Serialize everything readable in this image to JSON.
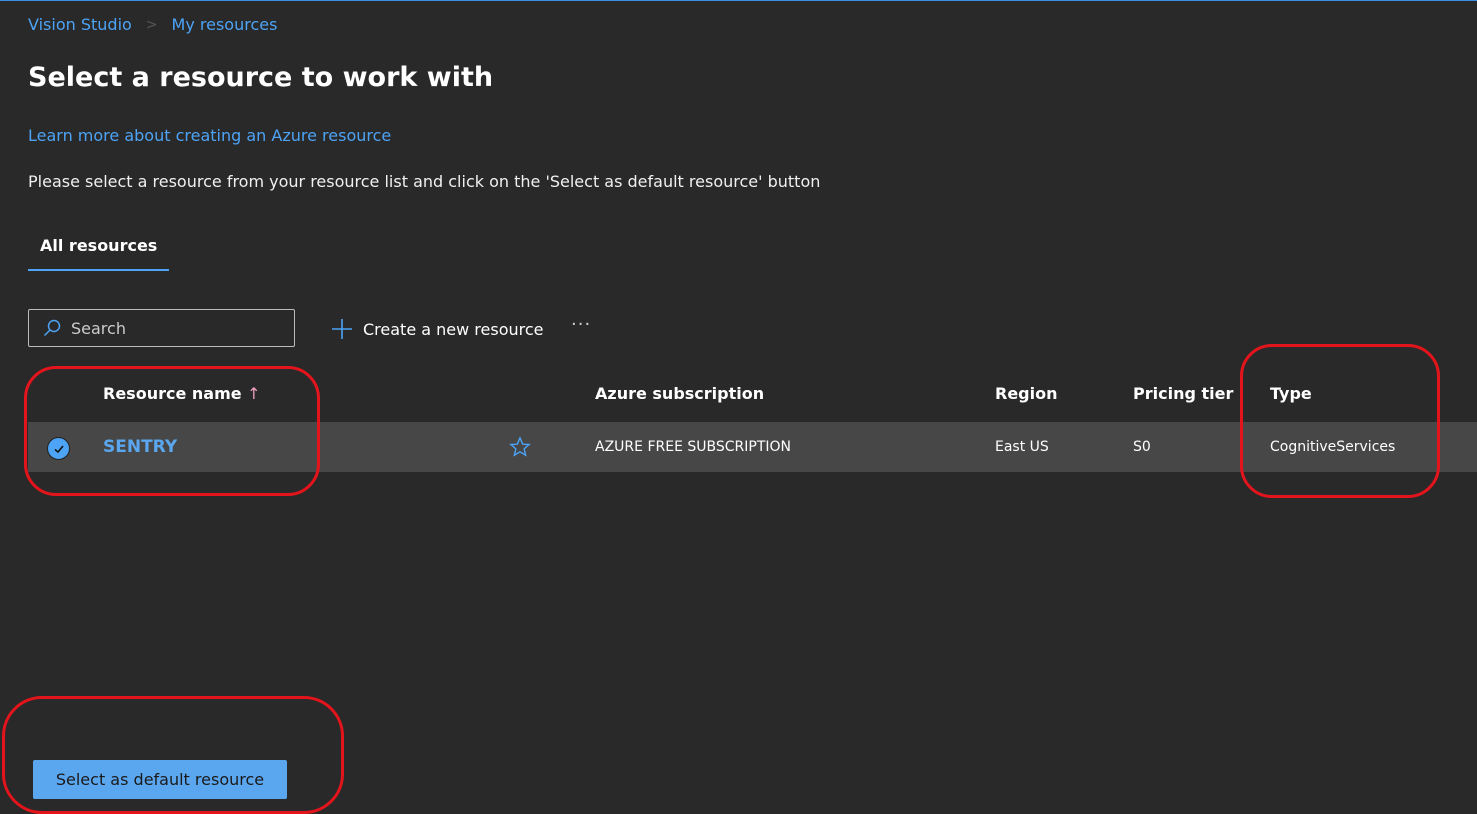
{
  "breadcrumb": {
    "items": [
      "Vision Studio",
      "My resources"
    ]
  },
  "page": {
    "title": "Select a resource to work with",
    "learn_link": "Learn more about creating an Azure resource",
    "description": "Please select a resource from your resource list and click on the 'Select as default resource' button"
  },
  "tabs": [
    {
      "label": "All resources",
      "active": true
    }
  ],
  "toolbar": {
    "search_placeholder": "Search",
    "create_label": "Create a new resource",
    "more_label": "···"
  },
  "table": {
    "columns": [
      "Resource name",
      "Azure subscription",
      "Region",
      "Pricing tier",
      "Type"
    ],
    "sort_indicator": "↑",
    "rows": [
      {
        "name": "SENTRY",
        "selected": true,
        "favorite_icon": "star-outline",
        "subscription": "AZURE FREE SUBSCRIPTION",
        "region": "East US",
        "pricing_tier": "S0",
        "type": "CognitiveServices"
      }
    ]
  },
  "footer": {
    "select_button": "Select as default resource"
  },
  "colors": {
    "accent": "#4da3f5",
    "annotation": "#e3141c",
    "background": "#292929"
  }
}
